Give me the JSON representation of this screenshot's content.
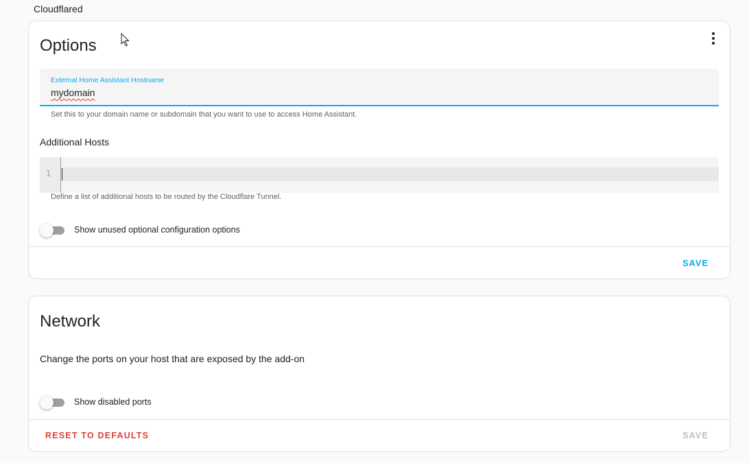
{
  "page": {
    "addon_name": "Cloudflared"
  },
  "options_card": {
    "title": "Options",
    "hostname_field": {
      "label": "External Home Assistant Hostname",
      "value": "mydomain",
      "helper": "Set this to your domain name or subdomain that you want to use to access Home Assistant."
    },
    "additional_hosts": {
      "label": "Additional Hosts",
      "line_number": "1",
      "helper": "Define a list of additional hosts to be routed by the Cloudflare Tunnel."
    },
    "toggle": {
      "label": "Show unused optional configuration options",
      "checked": false
    },
    "save_label": "SAVE",
    "menu_icon": "more-vert-icon"
  },
  "network_card": {
    "title": "Network",
    "description": "Change the ports on your host that are exposed by the add-on",
    "toggle": {
      "label": "Show disabled ports",
      "checked": false
    },
    "reset_label": "RESET TO DEFAULTS",
    "save_label": "SAVE"
  },
  "colors": {
    "primary": "#03a9f4",
    "error": "#db4437",
    "disabled": "#bdbdbd"
  }
}
